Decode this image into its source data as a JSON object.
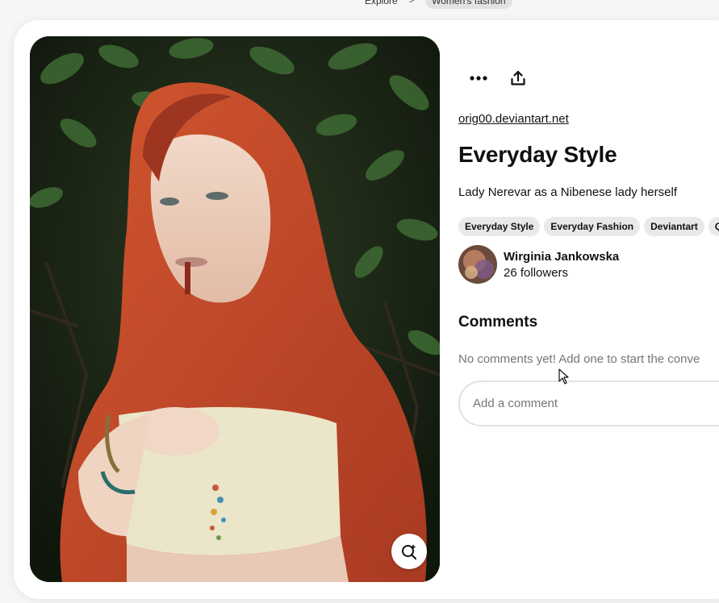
{
  "breadcrumb": {
    "items": [
      {
        "label": "Explore"
      },
      {
        "label": "Women's fashion"
      }
    ],
    "separator": ">"
  },
  "pin": {
    "image_alt": "Person in a rust-red hooded scarf and cream top holding a beaded necklace in front of dark green foliage",
    "source_link": "orig00.deviantart.net",
    "title": "Everyday Style",
    "description": "Lady Nerevar as a Nibenese lady herself",
    "tags": [
      "Everyday Style",
      "Everyday Fashion",
      "Deviantart",
      "Quic"
    ]
  },
  "actions": {
    "more_icon": "more-horizontal-icon",
    "share_icon": "share-upload-icon",
    "visual_search_icon": "visual-search-icon"
  },
  "creator": {
    "name": "Wirginia Jankowska",
    "followers": "26 followers"
  },
  "comments": {
    "heading": "Comments",
    "empty_text": "No comments yet! Add one to start the conve",
    "input_placeholder": "Add a comment"
  },
  "colors": {
    "scarf": "#c1452a",
    "foliage": "#1f3a1c",
    "tag_bg": "#e9e9e9",
    "muted_text": "#767676"
  }
}
